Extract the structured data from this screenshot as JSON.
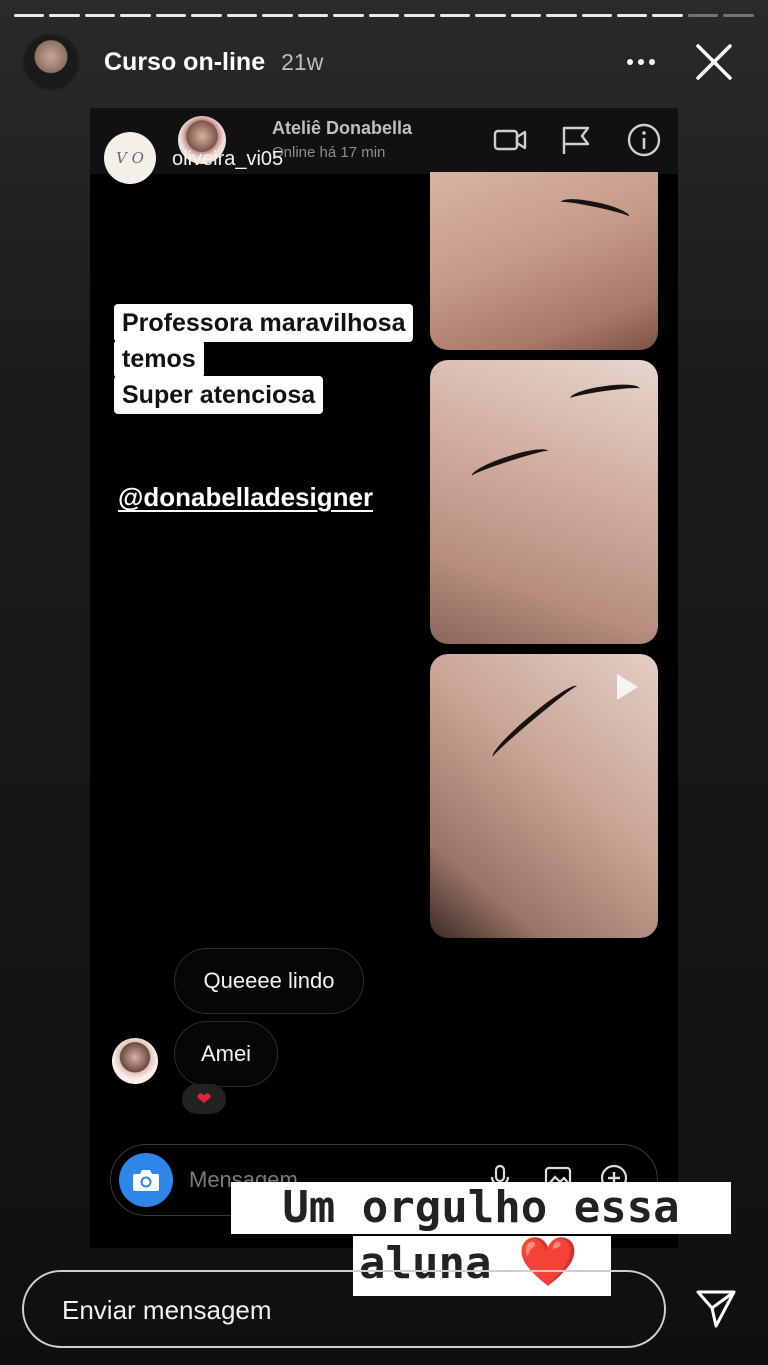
{
  "story": {
    "account_name": "Curso on-line",
    "time_ago": "21w",
    "progress_segments": 21,
    "progress_current": 19
  },
  "screenshot": {
    "dm_name": "Ateliê Donabella",
    "dm_status": "Online há 17 min",
    "badge_text": "V O",
    "handle": "oliveira_vi05",
    "caption_lines": [
      "Professora maravilhosa",
      "temos",
      "Super atenciosa"
    ],
    "mention": "@donabelladesigner",
    "messages": [
      "Queeee lindo",
      "Amei"
    ],
    "reaction": "❤",
    "composer_placeholder": "Mensagem"
  },
  "stickers": {
    "line1": "Um orgulho essa",
    "line2": "aluna",
    "heart": "❤️"
  },
  "reply": {
    "placeholder": "Enviar mensagem"
  },
  "icons": [
    "more-icon",
    "close-icon",
    "video-call-icon",
    "flag-icon",
    "info-icon",
    "play-icon",
    "camera-icon",
    "microphone-icon",
    "gallery-icon",
    "plus-icon",
    "send-icon"
  ],
  "colors": {
    "camera_button": "#2e86e8",
    "reaction_heart": "#e0243a"
  }
}
